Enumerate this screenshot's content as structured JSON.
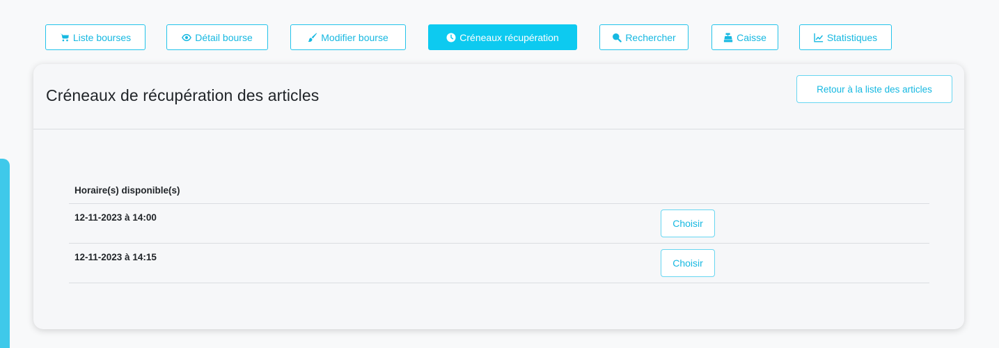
{
  "nav": {
    "tabs": [
      {
        "label": "Liste bourses",
        "icon": "cart-icon"
      },
      {
        "label": "Détail bourse",
        "icon": "eye-icon"
      },
      {
        "label": "Modifier bourse",
        "icon": "brush-icon"
      },
      {
        "label": "Créneaux récupération",
        "icon": "clock-icon",
        "active": true
      },
      {
        "label": "Rechercher",
        "icon": "search-icon"
      },
      {
        "label": "Caisse",
        "icon": "cash-register-icon"
      },
      {
        "label": "Statistiques",
        "icon": "chart-line-icon"
      }
    ]
  },
  "card": {
    "title": "Créneaux de récupération des articles",
    "back_button": "Retour à la liste des articles"
  },
  "slots": {
    "header": "Horaire(s) disponible(s)",
    "rows": [
      {
        "time": "12-11-2023 à 14:00",
        "action": "Choisir"
      },
      {
        "time": "12-11-2023 à 14:15",
        "action": "Choisir"
      }
    ]
  },
  "colors": {
    "accent": "#0dcaf0",
    "accent_text": "#16b8e1",
    "page_background": "#f8f9fa",
    "left_decoration": "#3fc9ea"
  }
}
